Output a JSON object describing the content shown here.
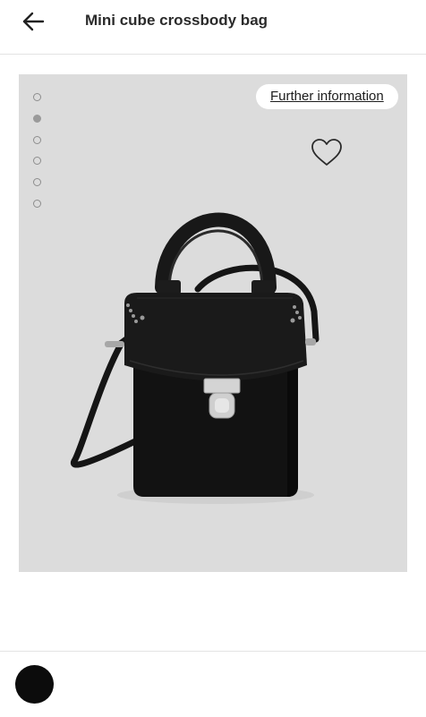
{
  "header": {
    "title": "Mini cube crossbody bag",
    "back_icon": "arrow-left-icon"
  },
  "gallery": {
    "further_info_label": "Further information",
    "wishlist_icon": "heart-icon",
    "image_count": 6,
    "active_image_index": 1,
    "background_color": "#dcdcdc"
  },
  "colors": {
    "selected_swatch": "#0c0c0c"
  }
}
